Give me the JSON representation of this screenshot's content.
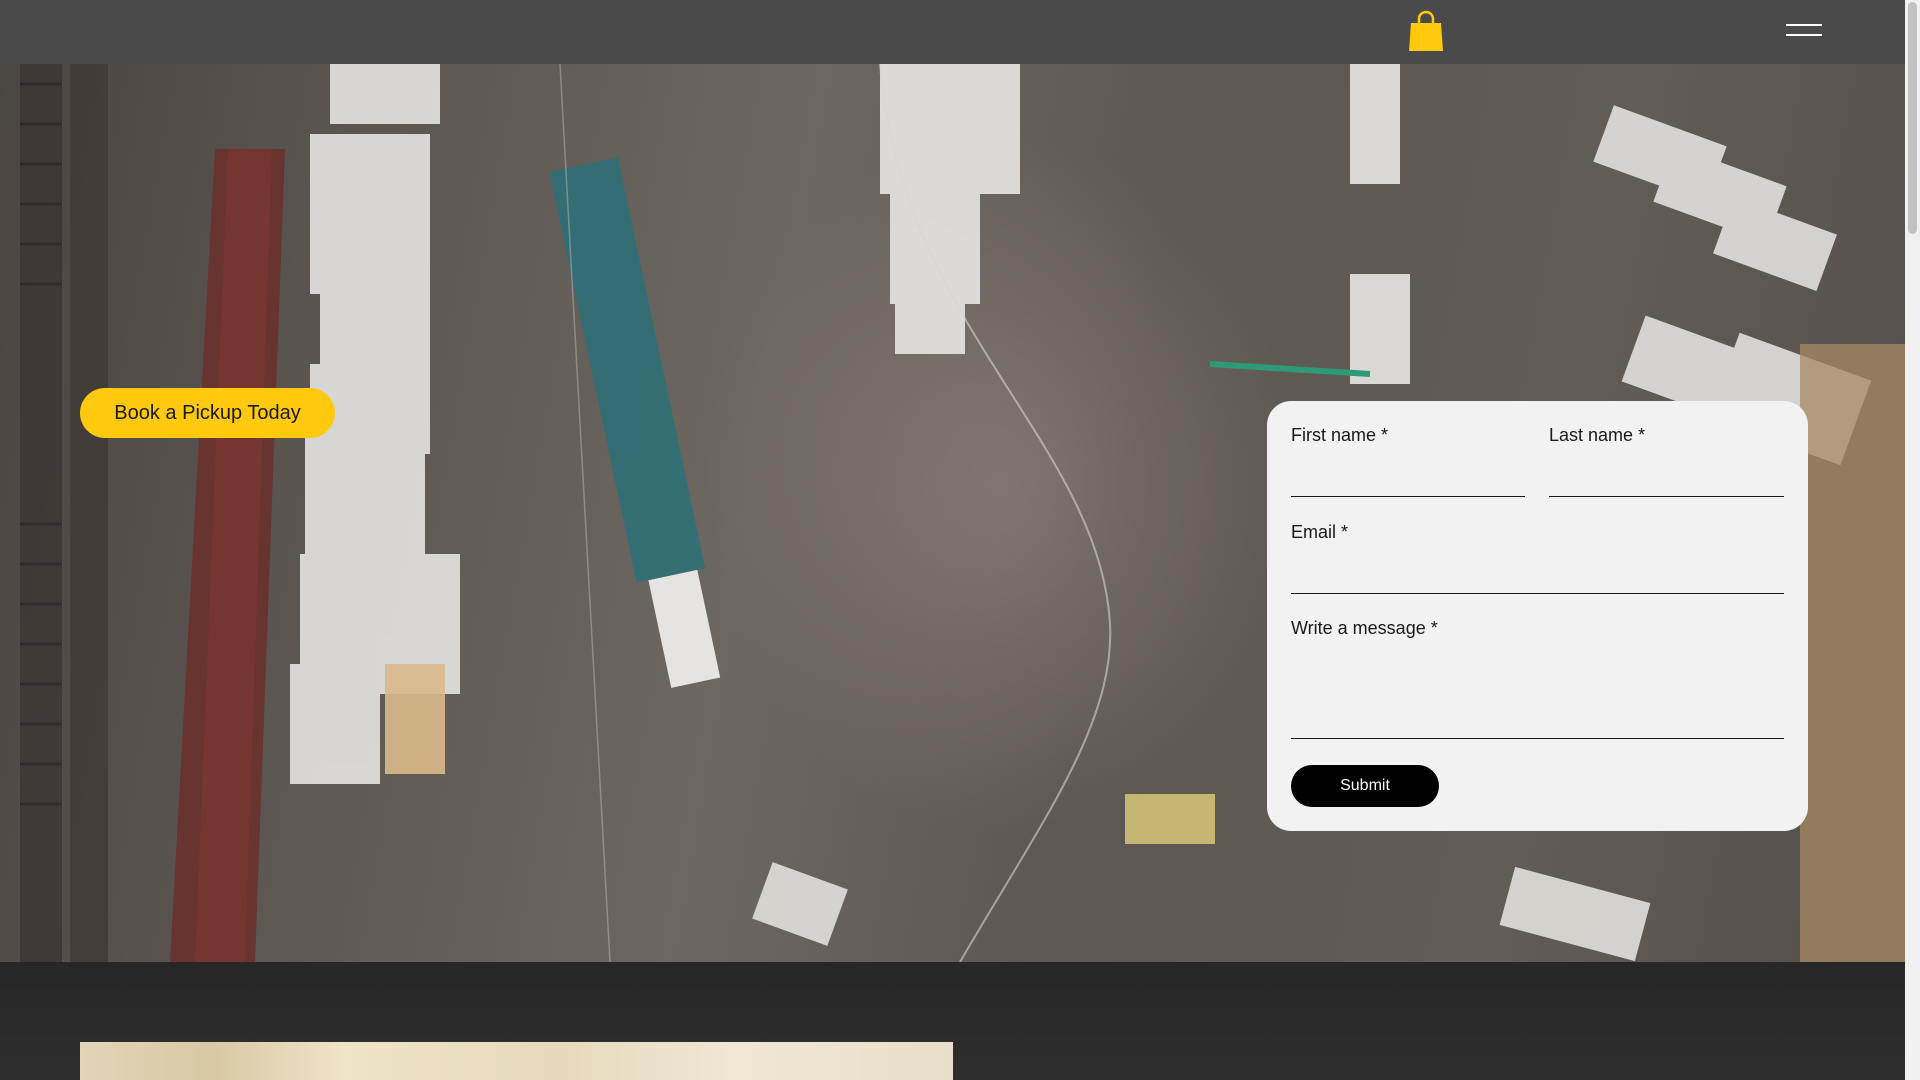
{
  "header": {
    "cart_icon": "shopping-bag-icon",
    "menu_icon": "hamburger-menu-icon",
    "accent_color": "#ffc90e"
  },
  "hero": {
    "cta_label": "Book a Pickup Today"
  },
  "contact_form": {
    "first_name_label": "First name",
    "last_name_label": "Last name",
    "email_label": "Email",
    "message_label": "Write a message",
    "required_marker": "*",
    "first_name_value": "",
    "last_name_value": "",
    "email_value": "",
    "message_value": "",
    "submit_label": "Submit"
  }
}
